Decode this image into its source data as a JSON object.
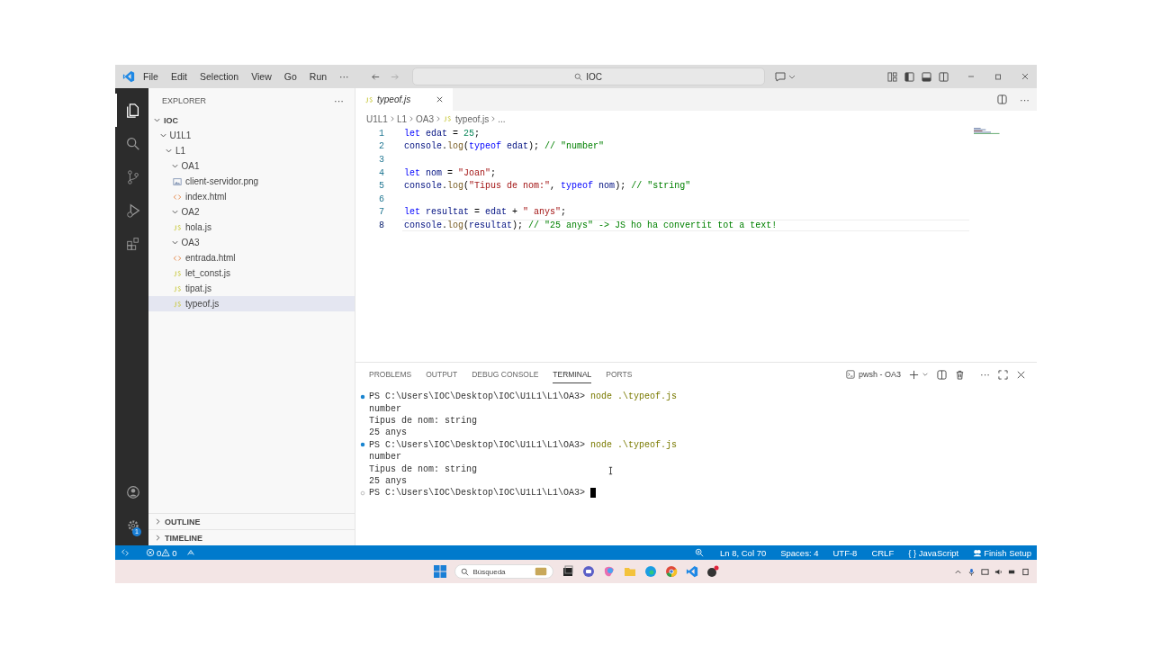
{
  "window": {
    "menu": [
      "File",
      "Edit",
      "Selection",
      "View",
      "Go",
      "Run"
    ],
    "menu_more": "···",
    "search": "IOC"
  },
  "activity_bar": {
    "settings_badge": "1"
  },
  "sidebar": {
    "title": "EXPLORER",
    "more": "···",
    "tree": [
      {
        "label": "IOC",
        "kind": "root",
        "expanded": true,
        "selected": false,
        "children": [
          {
            "label": "U1L1",
            "kind": "folder",
            "expanded": true,
            "selected": false,
            "children": [
              {
                "label": "L1",
                "kind": "folder",
                "expanded": true,
                "selected": false,
                "children": [
                  {
                    "label": "OA1",
                    "kind": "folder",
                    "expanded": true,
                    "selected": false,
                    "children": [
                      {
                        "label": "client-servidor.png",
                        "kind": "image",
                        "selected": false
                      },
                      {
                        "label": "index.html",
                        "kind": "html",
                        "selected": false
                      }
                    ]
                  },
                  {
                    "label": "OA2",
                    "kind": "folder",
                    "expanded": true,
                    "selected": false,
                    "children": [
                      {
                        "label": "hola.js",
                        "kind": "js",
                        "selected": false
                      }
                    ]
                  },
                  {
                    "label": "OA3",
                    "kind": "folder",
                    "expanded": true,
                    "selected": false,
                    "children": [
                      {
                        "label": "entrada.html",
                        "kind": "html",
                        "selected": false
                      },
                      {
                        "label": "let_const.js",
                        "kind": "js",
                        "selected": false
                      },
                      {
                        "label": "tipat.js",
                        "kind": "js",
                        "selected": false
                      },
                      {
                        "label": "typeof.js",
                        "kind": "js",
                        "selected": true
                      }
                    ]
                  }
                ]
              }
            ]
          }
        ]
      }
    ],
    "sections": [
      {
        "label": "OUTLINE",
        "expanded": false
      },
      {
        "label": "TIMELINE",
        "expanded": false
      }
    ]
  },
  "editor": {
    "tabs": [
      {
        "label": "typeof.js",
        "kind": "js",
        "selected": true,
        "preview": true
      }
    ],
    "breadcrumb": [
      {
        "label": "U1L1"
      },
      {
        "label": "L1"
      },
      {
        "label": "OA3"
      },
      {
        "label": "typeof.js",
        "kind": "js"
      },
      {
        "label": "..."
      }
    ],
    "lines": [
      {
        "number": "1",
        "active": false,
        "tokens": [
          {
            "kind": "kw",
            "t": "let "
          },
          {
            "kind": "id",
            "t": "edat"
          },
          {
            "kind": "p",
            "t": " = "
          },
          {
            "kind": "num",
            "t": "25"
          },
          {
            "kind": "p",
            "t": ";"
          }
        ]
      },
      {
        "number": "2",
        "active": false,
        "tokens": [
          {
            "kind": "id",
            "t": "console"
          },
          {
            "kind": "p",
            "t": "."
          },
          {
            "kind": "fn",
            "t": "log"
          },
          {
            "kind": "p",
            "t": "("
          },
          {
            "kind": "kw",
            "t": "typeof "
          },
          {
            "kind": "id",
            "t": "edat"
          },
          {
            "kind": "p",
            "t": "); "
          },
          {
            "kind": "cm",
            "t": "// \"number\""
          }
        ]
      },
      {
        "number": "3",
        "active": false
      },
      {
        "number": "4",
        "active": false,
        "tokens": [
          {
            "kind": "kw",
            "t": "let "
          },
          {
            "kind": "id",
            "t": "nom"
          },
          {
            "kind": "p",
            "t": " = "
          },
          {
            "kind": "str",
            "t": "\"Joan\""
          },
          {
            "kind": "p",
            "t": ";"
          }
        ]
      },
      {
        "number": "5",
        "active": false,
        "tokens": [
          {
            "kind": "id",
            "t": "console"
          },
          {
            "kind": "p",
            "t": "."
          },
          {
            "kind": "fn",
            "t": "log"
          },
          {
            "kind": "p",
            "t": "("
          },
          {
            "kind": "str",
            "t": "\"Tipus de nom:\""
          },
          {
            "kind": "p",
            "t": ", "
          },
          {
            "kind": "kw",
            "t": "typeof "
          },
          {
            "kind": "id",
            "t": "nom"
          },
          {
            "kind": "p",
            "t": "); "
          },
          {
            "kind": "cm",
            "t": "// \"string\""
          }
        ]
      },
      {
        "number": "6",
        "active": false
      },
      {
        "number": "7",
        "active": false,
        "tokens": [
          {
            "kind": "kw",
            "t": "let "
          },
          {
            "kind": "id",
            "t": "resultat"
          },
          {
            "kind": "p",
            "t": " = "
          },
          {
            "kind": "id",
            "t": "edat"
          },
          {
            "kind": "p",
            "t": " + "
          },
          {
            "kind": "str",
            "t": "\" anys\""
          },
          {
            "kind": "p",
            "t": ";"
          }
        ]
      },
      {
        "number": "8",
        "active": true,
        "tokens": [
          {
            "kind": "id",
            "t": "console"
          },
          {
            "kind": "p",
            "t": "."
          },
          {
            "kind": "fn",
            "t": "log"
          },
          {
            "kind": "p",
            "t": "("
          },
          {
            "kind": "id",
            "t": "resultat"
          },
          {
            "kind": "p",
            "t": "); "
          },
          {
            "kind": "cm",
            "t": "// \"25 anys\" -> JS ho ha convertit tot a text!"
          }
        ]
      }
    ]
  },
  "panel": {
    "tabs": [
      {
        "label": "PROBLEMS",
        "selected": false
      },
      {
        "label": "OUTPUT",
        "selected": false
      },
      {
        "label": "DEBUG CONSOLE",
        "selected": false
      },
      {
        "label": "TERMINAL",
        "selected": true
      },
      {
        "label": "PORTS",
        "selected": false
      }
    ],
    "terminal_name": "pwsh - OA3",
    "more": "···",
    "lines": [
      {
        "kind": "prompt",
        "succeeded": true,
        "prompt": "PS C:\\Users\\IOC\\Desktop\\IOC\\U1L1\\L1\\OA3>",
        "command": "node .\\typeof.js"
      },
      {
        "kind": "output",
        "text": "number"
      },
      {
        "kind": "output",
        "text": "Tipus de nom: string"
      },
      {
        "kind": "output",
        "text": "25 anys"
      },
      {
        "kind": "prompt",
        "succeeded": true,
        "prompt": "PS C:\\Users\\IOC\\Desktop\\IOC\\U1L1\\L1\\OA3>",
        "command": "node .\\typeof.js"
      },
      {
        "kind": "output",
        "text": "number"
      },
      {
        "kind": "output",
        "text": "Tipus de nom: string"
      },
      {
        "kind": "output",
        "text": "25 anys"
      },
      {
        "kind": "prompt",
        "succeeded": false,
        "prompt": "PS C:\\Users\\IOC\\Desktop\\IOC\\U1L1\\L1\\OA3>",
        "cursor": true
      }
    ]
  },
  "status_bar": {
    "errors": "0",
    "warnings": "0",
    "position": "Ln 8, Col 70",
    "indent": "Spaces: 4",
    "encoding": "UTF-8",
    "eol": "CRLF",
    "language_braces": "{ }",
    "language": "JavaScript",
    "setup": "Finish Setup"
  },
  "taskbar": {
    "search_placeholder": "Búsqueda"
  }
}
